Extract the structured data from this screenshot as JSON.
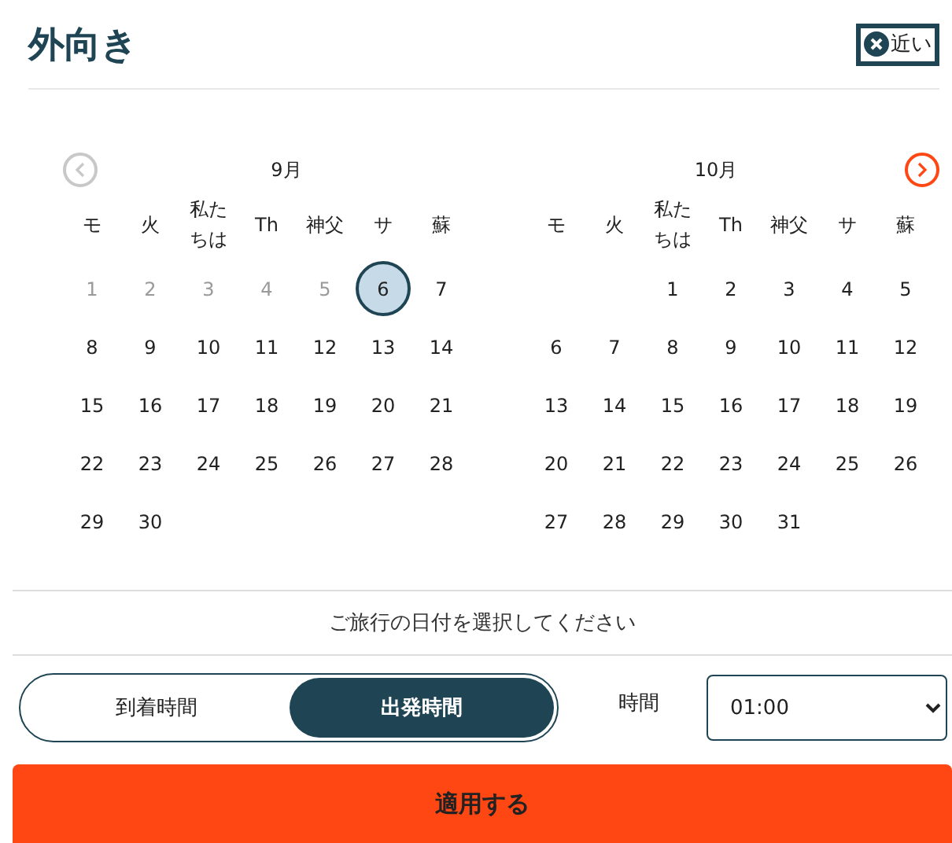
{
  "title": "外向き",
  "close_button": {
    "label": "近い"
  },
  "nav": {
    "prev_disabled": true,
    "next_disabled": false
  },
  "months": [
    {
      "name": "9月",
      "weekdays": [
        "モ",
        "火",
        "私たちは",
        "Th",
        "神父",
        "サ",
        "蘇"
      ],
      "weeks": [
        [
          {
            "kind": "day",
            "label": "1",
            "disabled": true,
            "selected": false
          },
          {
            "kind": "day",
            "label": "2",
            "disabled": true,
            "selected": false
          },
          {
            "kind": "day",
            "label": "3",
            "disabled": true,
            "selected": false
          },
          {
            "kind": "day",
            "label": "4",
            "disabled": true,
            "selected": false
          },
          {
            "kind": "day",
            "label": "5",
            "disabled": true,
            "selected": false
          },
          {
            "kind": "day",
            "label": "6",
            "disabled": false,
            "selected": true
          },
          {
            "kind": "day",
            "label": "7",
            "disabled": false,
            "selected": false
          }
        ],
        [
          {
            "kind": "day",
            "label": "8",
            "disabled": false,
            "selected": false
          },
          {
            "kind": "day",
            "label": "9",
            "disabled": false,
            "selected": false
          },
          {
            "kind": "day",
            "label": "10",
            "disabled": false,
            "selected": false
          },
          {
            "kind": "day",
            "label": "11",
            "disabled": false,
            "selected": false
          },
          {
            "kind": "day",
            "label": "12",
            "disabled": false,
            "selected": false
          },
          {
            "kind": "day",
            "label": "13",
            "disabled": false,
            "selected": false
          },
          {
            "kind": "day",
            "label": "14",
            "disabled": false,
            "selected": false
          }
        ],
        [
          {
            "kind": "day",
            "label": "15",
            "disabled": false,
            "selected": false
          },
          {
            "kind": "day",
            "label": "16",
            "disabled": false,
            "selected": false
          },
          {
            "kind": "day",
            "label": "17",
            "disabled": false,
            "selected": false
          },
          {
            "kind": "day",
            "label": "18",
            "disabled": false,
            "selected": false
          },
          {
            "kind": "day",
            "label": "19",
            "disabled": false,
            "selected": false
          },
          {
            "kind": "day",
            "label": "20",
            "disabled": false,
            "selected": false
          },
          {
            "kind": "day",
            "label": "21",
            "disabled": false,
            "selected": false
          }
        ],
        [
          {
            "kind": "day",
            "label": "22",
            "disabled": false,
            "selected": false
          },
          {
            "kind": "day",
            "label": "23",
            "disabled": false,
            "selected": false
          },
          {
            "kind": "day",
            "label": "24",
            "disabled": false,
            "selected": false
          },
          {
            "kind": "day",
            "label": "25",
            "disabled": false,
            "selected": false
          },
          {
            "kind": "day",
            "label": "26",
            "disabled": false,
            "selected": false
          },
          {
            "kind": "day",
            "label": "27",
            "disabled": false,
            "selected": false
          },
          {
            "kind": "day",
            "label": "28",
            "disabled": false,
            "selected": false
          }
        ],
        [
          {
            "kind": "day",
            "label": "29",
            "disabled": false,
            "selected": false
          },
          {
            "kind": "day",
            "label": "30",
            "disabled": false,
            "selected": false
          }
        ]
      ]
    },
    {
      "name": "10月",
      "weekdays": [
        "モ",
        "火",
        "私たちは",
        "Th",
        "神父",
        "サ",
        "蘇"
      ],
      "weeks": [
        [
          {
            "kind": "blank"
          },
          {
            "kind": "blank"
          },
          {
            "kind": "day",
            "label": "1",
            "disabled": false,
            "selected": false
          },
          {
            "kind": "day",
            "label": "2",
            "disabled": false,
            "selected": false
          },
          {
            "kind": "day",
            "label": "3",
            "disabled": false,
            "selected": false
          },
          {
            "kind": "day",
            "label": "4",
            "disabled": false,
            "selected": false
          },
          {
            "kind": "day",
            "label": "5",
            "disabled": false,
            "selected": false
          }
        ],
        [
          {
            "kind": "day",
            "label": "6",
            "disabled": false,
            "selected": false
          },
          {
            "kind": "day",
            "label": "7",
            "disabled": false,
            "selected": false
          },
          {
            "kind": "day",
            "label": "8",
            "disabled": false,
            "selected": false
          },
          {
            "kind": "day",
            "label": "9",
            "disabled": false,
            "selected": false
          },
          {
            "kind": "day",
            "label": "10",
            "disabled": false,
            "selected": false
          },
          {
            "kind": "day",
            "label": "11",
            "disabled": false,
            "selected": false
          },
          {
            "kind": "day",
            "label": "12",
            "disabled": false,
            "selected": false
          }
        ],
        [
          {
            "kind": "day",
            "label": "13",
            "disabled": false,
            "selected": false
          },
          {
            "kind": "day",
            "label": "14",
            "disabled": false,
            "selected": false
          },
          {
            "kind": "day",
            "label": "15",
            "disabled": false,
            "selected": false
          },
          {
            "kind": "day",
            "label": "16",
            "disabled": false,
            "selected": false
          },
          {
            "kind": "day",
            "label": "17",
            "disabled": false,
            "selected": false
          },
          {
            "kind": "day",
            "label": "18",
            "disabled": false,
            "selected": false
          },
          {
            "kind": "day",
            "label": "19",
            "disabled": false,
            "selected": false
          }
        ],
        [
          {
            "kind": "day",
            "label": "20",
            "disabled": false,
            "selected": false
          },
          {
            "kind": "day",
            "label": "21",
            "disabled": false,
            "selected": false
          },
          {
            "kind": "day",
            "label": "22",
            "disabled": false,
            "selected": false
          },
          {
            "kind": "day",
            "label": "23",
            "disabled": false,
            "selected": false
          },
          {
            "kind": "day",
            "label": "24",
            "disabled": false,
            "selected": false
          },
          {
            "kind": "day",
            "label": "25",
            "disabled": false,
            "selected": false
          },
          {
            "kind": "day",
            "label": "26",
            "disabled": false,
            "selected": false
          }
        ],
        [
          {
            "kind": "day",
            "label": "27",
            "disabled": false,
            "selected": false
          },
          {
            "kind": "day",
            "label": "28",
            "disabled": false,
            "selected": false
          },
          {
            "kind": "day",
            "label": "29",
            "disabled": false,
            "selected": false
          },
          {
            "kind": "day",
            "label": "30",
            "disabled": false,
            "selected": false
          },
          {
            "kind": "day",
            "label": "31",
            "disabled": false,
            "selected": false
          }
        ]
      ]
    }
  ],
  "hint": "ご旅行の日付を選択してください",
  "toggle": [
    {
      "label": "到着時間",
      "selected": false
    },
    {
      "label": "出発時間",
      "selected": true
    }
  ],
  "time": {
    "label": "時間",
    "value": "01:00"
  },
  "apply_button": {
    "label": "適用する"
  }
}
